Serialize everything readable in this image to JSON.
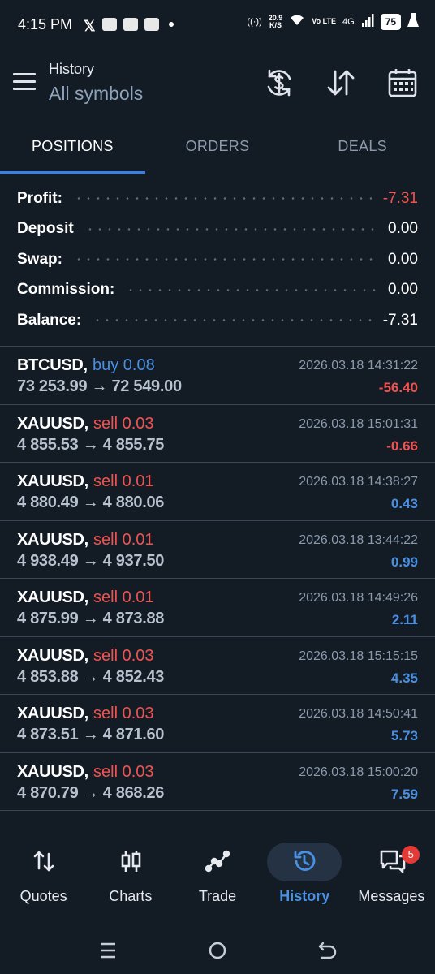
{
  "status_bar": {
    "time": "4:15 PM",
    "net_speed_value": "20.9",
    "net_speed_unit": "K/S",
    "volte": "Vo LTE",
    "network": "4G",
    "battery": "75"
  },
  "header": {
    "title": "History",
    "subtitle": "All symbols"
  },
  "tabs": [
    {
      "label": "POSITIONS",
      "active": true
    },
    {
      "label": "ORDERS",
      "active": false
    },
    {
      "label": "DEALS",
      "active": false
    }
  ],
  "summary": {
    "profit_label": "Profit:",
    "profit_value": "-7.31",
    "deposit_label": "Deposit",
    "deposit_value": "0.00",
    "swap_label": "Swap:",
    "swap_value": "0.00",
    "commission_label": "Commission:",
    "commission_value": "0.00",
    "balance_label": "Balance:",
    "balance_value": "-7.31"
  },
  "deals": [
    {
      "symbol": "BTCUSD,",
      "type": "buy 0.08",
      "side": "buy",
      "prices": "73 253.99 → 72 549.00",
      "time": "2026.03.18 14:31:22",
      "profit": "-56.40",
      "sign": "neg"
    },
    {
      "symbol": "XAUUSD,",
      "type": "sell 0.03",
      "side": "sell",
      "prices": "4 855.53 → 4 855.75",
      "time": "2026.03.18 15:01:31",
      "profit": "-0.66",
      "sign": "neg"
    },
    {
      "symbol": "XAUUSD,",
      "type": "sell 0.01",
      "side": "sell",
      "prices": "4 880.49 → 4 880.06",
      "time": "2026.03.18 14:38:27",
      "profit": "0.43",
      "sign": "pos"
    },
    {
      "symbol": "XAUUSD,",
      "type": "sell 0.01",
      "side": "sell",
      "prices": "4 938.49 → 4 937.50",
      "time": "2026.03.18 13:44:22",
      "profit": "0.99",
      "sign": "pos"
    },
    {
      "symbol": "XAUUSD,",
      "type": "sell 0.01",
      "side": "sell",
      "prices": "4 875.99 → 4 873.88",
      "time": "2026.03.18 14:49:26",
      "profit": "2.11",
      "sign": "pos"
    },
    {
      "symbol": "XAUUSD,",
      "type": "sell 0.03",
      "side": "sell",
      "prices": "4 853.88 → 4 852.43",
      "time": "2026.03.18 15:15:15",
      "profit": "4.35",
      "sign": "pos"
    },
    {
      "symbol": "XAUUSD,",
      "type": "sell 0.03",
      "side": "sell",
      "prices": "4 873.51 → 4 871.60",
      "time": "2026.03.18 14:50:41",
      "profit": "5.73",
      "sign": "pos"
    },
    {
      "symbol": "XAUUSD,",
      "type": "sell 0.03",
      "side": "sell",
      "prices": "4 870.79 → 4 868.26",
      "time": "2026.03.18 15:00:20",
      "profit": "7.59",
      "sign": "pos"
    }
  ],
  "bottom_nav": [
    {
      "label": "Quotes",
      "icon": "quotes-arrows-icon",
      "active": false
    },
    {
      "label": "Charts",
      "icon": "candlestick-icon",
      "active": false
    },
    {
      "label": "Trade",
      "icon": "trade-line-icon",
      "active": false
    },
    {
      "label": "History",
      "icon": "history-clock-icon",
      "active": true
    },
    {
      "label": "Messages",
      "icon": "message-bubble-icon",
      "active": false,
      "badge": "5"
    }
  ],
  "colors": {
    "background": "#131b25",
    "accent": "#4a90e2",
    "negative": "#ef5350",
    "positive": "#4a90e2",
    "buy": "#4a90e2",
    "sell": "#ef5350"
  }
}
